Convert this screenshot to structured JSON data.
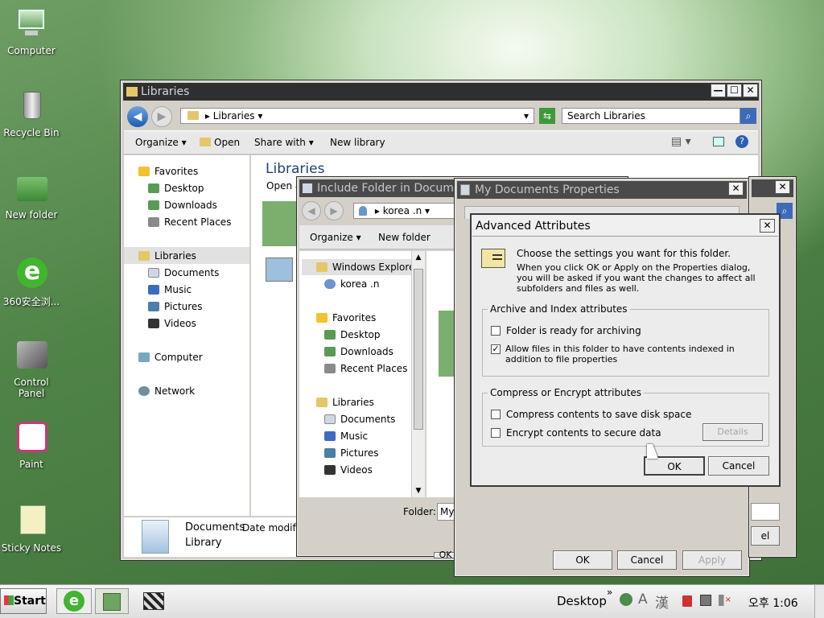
{
  "desktop": {
    "icons": [
      {
        "label": "Computer"
      },
      {
        "label": "Recycle Bin"
      },
      {
        "label": "New folder"
      },
      {
        "label": "360安全浏..."
      },
      {
        "label": "Control Panel"
      },
      {
        "label": "Paint"
      },
      {
        "label": "Sticky Notes"
      }
    ]
  },
  "explorer": {
    "title": "Libraries",
    "breadcrumb": "Libraries",
    "search_placeholder": "Search Libraries",
    "toolbar": {
      "organize": "Organize",
      "open": "Open",
      "share_with": "Share with",
      "new_library": "New library"
    },
    "nav": {
      "favorites": "Favorites",
      "desktop": "Desktop",
      "downloads": "Downloads",
      "recent_places": "Recent Places",
      "libraries": "Libraries",
      "documents": "Documents",
      "music": "Music",
      "pictures": "Pictures",
      "videos": "Videos",
      "computer": "Computer",
      "network": "Network"
    },
    "content_heading": "Libraries",
    "content_sub": "Open a",
    "details": {
      "name": "Documents",
      "type": "Library",
      "column": "Date modifie"
    }
  },
  "include_folder": {
    "title": "Include Folder in Documents",
    "location": "korea .n",
    "toolbar": {
      "organize": "Organize",
      "new_folder": "New folder"
    },
    "nav": {
      "windows_explorer": "Windows Explorer",
      "korea": "korea .n",
      "favorites": "Favorites",
      "desktop": "Desktop",
      "downloads": "Downloads",
      "recent_places": "Recent Places",
      "libraries": "Libraries",
      "documents": "Documents",
      "music": "Music",
      "pictures": "Pictures",
      "videos": "Videos"
    },
    "folder_label": "Folder:",
    "folder_value": "My",
    "ok_partial": "OK"
  },
  "properties": {
    "title": "My Documents Properties",
    "ok": "OK",
    "cancel": "Cancel",
    "apply": "Apply",
    "cancel_partial": "el"
  },
  "advanced": {
    "title": "Advanced Attributes",
    "intro": "Choose the settings you want for this folder.",
    "intro2": "When you click OK or Apply on the Properties dialog, you will be asked if you want the changes to affect all subfolders and files as well.",
    "archive_group": "Archive and Index attributes",
    "archive_label": "Folder is ready for archiving",
    "archive_checked": false,
    "index_label": "Allow files in this folder to have contents indexed in addition to file properties",
    "index_checked": true,
    "compress_group": "Compress or Encrypt attributes",
    "compress_label": "Compress contents to save disk space",
    "compress_checked": false,
    "encrypt_label": "Encrypt contents to secure data",
    "encrypt_checked": false,
    "details": "Details",
    "ok": "OK",
    "cancel": "Cancel"
  },
  "taskbar": {
    "start": "Start",
    "toolbar_label": "Desktop",
    "ime1": "A",
    "ime2": "漢",
    "clock": "오후 1:06"
  },
  "colors": {
    "accent": "#2f2f2f",
    "desktop": "#4f8447"
  }
}
